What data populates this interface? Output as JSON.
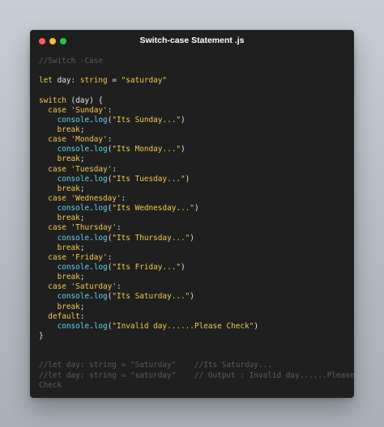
{
  "window": {
    "title": "Switch-case Statement .js",
    "controls": [
      "close",
      "minimize",
      "zoom"
    ]
  },
  "code": {
    "lines": [
      [
        {
          "t": "//Switch -Case",
          "c": "com"
        }
      ],
      [],
      [
        {
          "t": "let",
          "c": "kw"
        },
        {
          "t": " day",
          "c": "var"
        },
        {
          "t": ": ",
          "c": "plain"
        },
        {
          "t": "string",
          "c": "type"
        },
        {
          "t": " = ",
          "c": "plain"
        },
        {
          "t": "\"saturday\"",
          "c": "str"
        }
      ],
      [],
      [
        {
          "t": "switch",
          "c": "kw"
        },
        {
          "t": " (day) {",
          "c": "plain"
        }
      ],
      [
        {
          "t": "  ",
          "c": "plain"
        },
        {
          "t": "case",
          "c": "kw"
        },
        {
          "t": " ",
          "c": "plain"
        },
        {
          "t": "'Sunday'",
          "c": "str"
        },
        {
          "t": ":",
          "c": "plain"
        }
      ],
      [
        {
          "t": "    ",
          "c": "plain"
        },
        {
          "t": "console",
          "c": "fn"
        },
        {
          "t": ".",
          "c": "plain"
        },
        {
          "t": "log",
          "c": "fn"
        },
        {
          "t": "(",
          "c": "plain"
        },
        {
          "t": "\"Its Sunday...\"",
          "c": "str"
        },
        {
          "t": ")",
          "c": "plain"
        }
      ],
      [
        {
          "t": "    ",
          "c": "plain"
        },
        {
          "t": "break",
          "c": "kw"
        },
        {
          "t": ";",
          "c": "plain"
        }
      ],
      [
        {
          "t": "  ",
          "c": "plain"
        },
        {
          "t": "case",
          "c": "kw"
        },
        {
          "t": " ",
          "c": "plain"
        },
        {
          "t": "'Monday'",
          "c": "str"
        },
        {
          "t": ":",
          "c": "plain"
        }
      ],
      [
        {
          "t": "    ",
          "c": "plain"
        },
        {
          "t": "console",
          "c": "fn"
        },
        {
          "t": ".",
          "c": "plain"
        },
        {
          "t": "log",
          "c": "fn"
        },
        {
          "t": "(",
          "c": "plain"
        },
        {
          "t": "\"Its Monday...\"",
          "c": "str"
        },
        {
          "t": ")",
          "c": "plain"
        }
      ],
      [
        {
          "t": "    ",
          "c": "plain"
        },
        {
          "t": "break",
          "c": "kw"
        },
        {
          "t": ";",
          "c": "plain"
        }
      ],
      [
        {
          "t": "  ",
          "c": "plain"
        },
        {
          "t": "case",
          "c": "kw"
        },
        {
          "t": " ",
          "c": "plain"
        },
        {
          "t": "'Tuesday'",
          "c": "str"
        },
        {
          "t": ":",
          "c": "plain"
        }
      ],
      [
        {
          "t": "    ",
          "c": "plain"
        },
        {
          "t": "console",
          "c": "fn"
        },
        {
          "t": ".",
          "c": "plain"
        },
        {
          "t": "log",
          "c": "fn"
        },
        {
          "t": "(",
          "c": "plain"
        },
        {
          "t": "\"Its Tuesday...\"",
          "c": "str"
        },
        {
          "t": ")",
          "c": "plain"
        }
      ],
      [
        {
          "t": "    ",
          "c": "plain"
        },
        {
          "t": "break",
          "c": "kw"
        },
        {
          "t": ";",
          "c": "plain"
        }
      ],
      [
        {
          "t": "  ",
          "c": "plain"
        },
        {
          "t": "case",
          "c": "kw"
        },
        {
          "t": " ",
          "c": "plain"
        },
        {
          "t": "'Wednesday'",
          "c": "str"
        },
        {
          "t": ":",
          "c": "plain"
        }
      ],
      [
        {
          "t": "    ",
          "c": "plain"
        },
        {
          "t": "console",
          "c": "fn"
        },
        {
          "t": ".",
          "c": "plain"
        },
        {
          "t": "log",
          "c": "fn"
        },
        {
          "t": "(",
          "c": "plain"
        },
        {
          "t": "\"Its Wednesday...\"",
          "c": "str"
        },
        {
          "t": ")",
          "c": "plain"
        }
      ],
      [
        {
          "t": "    ",
          "c": "plain"
        },
        {
          "t": "break",
          "c": "kw"
        },
        {
          "t": ";",
          "c": "plain"
        }
      ],
      [
        {
          "t": "  ",
          "c": "plain"
        },
        {
          "t": "case",
          "c": "kw"
        },
        {
          "t": " ",
          "c": "plain"
        },
        {
          "t": "'Thursday'",
          "c": "str"
        },
        {
          "t": ":",
          "c": "plain"
        }
      ],
      [
        {
          "t": "    ",
          "c": "plain"
        },
        {
          "t": "console",
          "c": "fn"
        },
        {
          "t": ".",
          "c": "plain"
        },
        {
          "t": "log",
          "c": "fn"
        },
        {
          "t": "(",
          "c": "plain"
        },
        {
          "t": "\"Its Thursday...\"",
          "c": "str"
        },
        {
          "t": ")",
          "c": "plain"
        }
      ],
      [
        {
          "t": "    ",
          "c": "plain"
        },
        {
          "t": "break",
          "c": "kw"
        },
        {
          "t": ";",
          "c": "plain"
        }
      ],
      [
        {
          "t": "  ",
          "c": "plain"
        },
        {
          "t": "case",
          "c": "kw"
        },
        {
          "t": " ",
          "c": "plain"
        },
        {
          "t": "'Friday'",
          "c": "str"
        },
        {
          "t": ":",
          "c": "plain"
        }
      ],
      [
        {
          "t": "    ",
          "c": "plain"
        },
        {
          "t": "console",
          "c": "fn"
        },
        {
          "t": ".",
          "c": "plain"
        },
        {
          "t": "log",
          "c": "fn"
        },
        {
          "t": "(",
          "c": "plain"
        },
        {
          "t": "\"Its Friday...\"",
          "c": "str"
        },
        {
          "t": ")",
          "c": "plain"
        }
      ],
      [
        {
          "t": "    ",
          "c": "plain"
        },
        {
          "t": "break",
          "c": "kw"
        },
        {
          "t": ";",
          "c": "plain"
        }
      ],
      [
        {
          "t": "  ",
          "c": "plain"
        },
        {
          "t": "case",
          "c": "kw"
        },
        {
          "t": " ",
          "c": "plain"
        },
        {
          "t": "'Saturday'",
          "c": "str"
        },
        {
          "t": ":",
          "c": "plain"
        }
      ],
      [
        {
          "t": "    ",
          "c": "plain"
        },
        {
          "t": "console",
          "c": "fn"
        },
        {
          "t": ".",
          "c": "plain"
        },
        {
          "t": "log",
          "c": "fn"
        },
        {
          "t": "(",
          "c": "plain"
        },
        {
          "t": "\"Its Saturday...\"",
          "c": "str"
        },
        {
          "t": ")",
          "c": "plain"
        }
      ],
      [
        {
          "t": "    ",
          "c": "plain"
        },
        {
          "t": "break",
          "c": "kw"
        },
        {
          "t": ";",
          "c": "plain"
        }
      ],
      [
        {
          "t": "  ",
          "c": "plain"
        },
        {
          "t": "default",
          "c": "kw"
        },
        {
          "t": ":",
          "c": "plain"
        }
      ],
      [
        {
          "t": "    ",
          "c": "plain"
        },
        {
          "t": "console",
          "c": "fn"
        },
        {
          "t": ".",
          "c": "plain"
        },
        {
          "t": "log",
          "c": "fn"
        },
        {
          "t": "(",
          "c": "plain"
        },
        {
          "t": "\"Invalid day......Please Check\"",
          "c": "str"
        },
        {
          "t": ")",
          "c": "plain"
        }
      ],
      [
        {
          "t": "}",
          "c": "plain"
        }
      ],
      [],
      [],
      [
        {
          "t": "//let day: string = \"Saturday\"    //Its Saturday...",
          "c": "com"
        }
      ],
      [
        {
          "t": "//let day: string = \"saturday\"    // Output : Invalid day......Please",
          "c": "com"
        }
      ],
      [
        {
          "t": "Check",
          "c": "com"
        }
      ]
    ]
  },
  "colors": {
    "background": "#1f1f1f",
    "keyword": "#f2c94c",
    "string": "#f2c94c",
    "function": "#5fd3f3",
    "comment": "#5d5d5d",
    "text": "#e6e6e6"
  }
}
